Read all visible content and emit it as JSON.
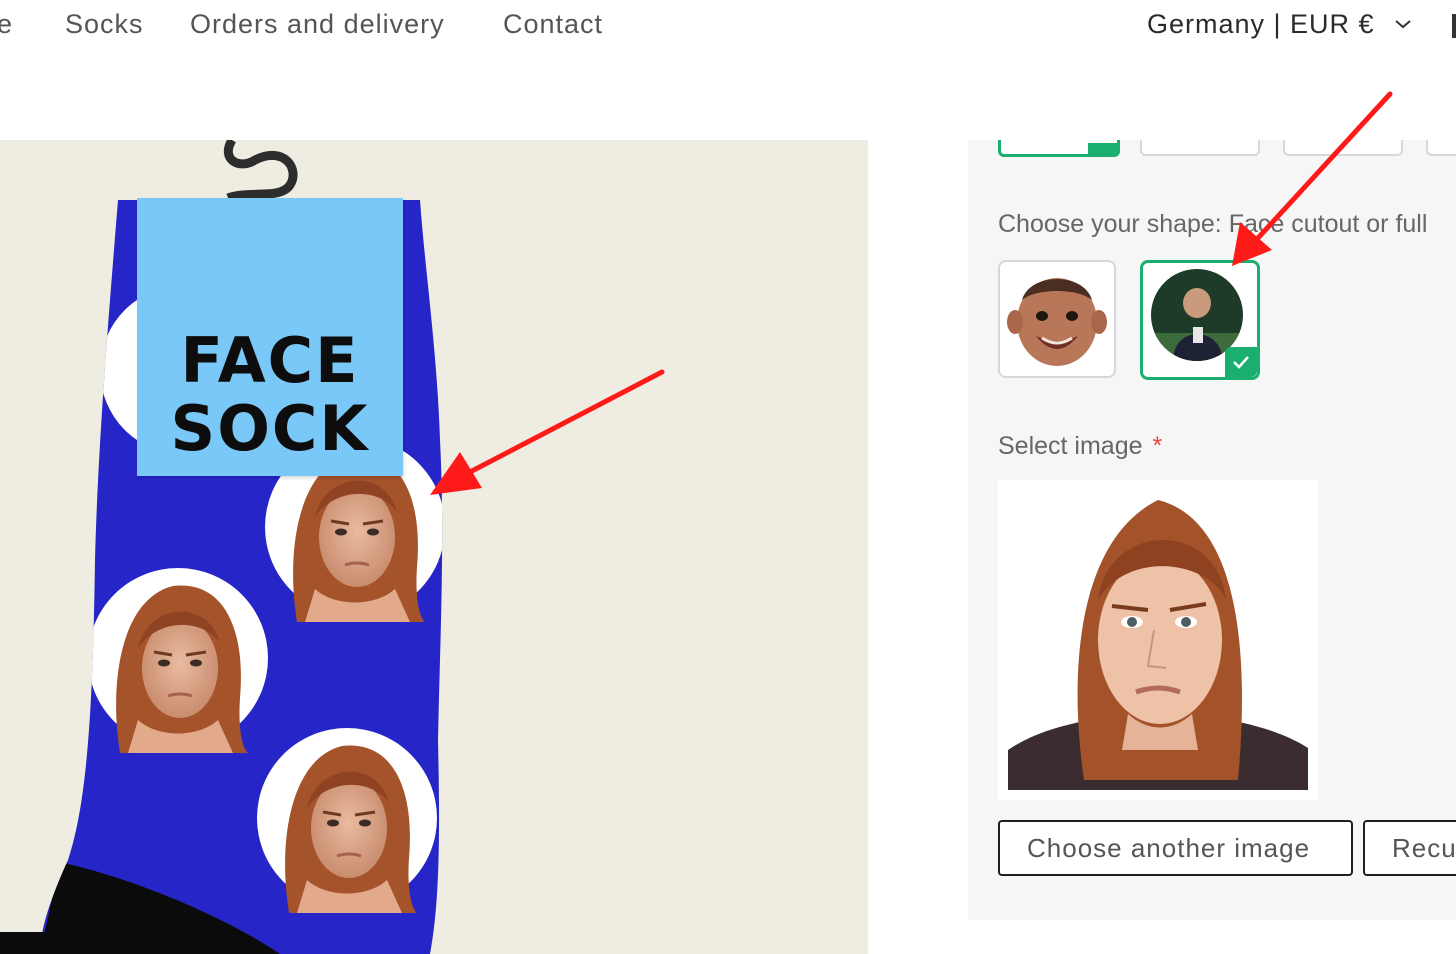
{
  "nav": {
    "links": [
      {
        "label": "e"
      },
      {
        "label": "Socks"
      },
      {
        "label": "Orders and delivery"
      },
      {
        "label": "Contact"
      }
    ],
    "region_label": "Germany | EUR €"
  },
  "preview": {
    "tag_lines": [
      "FACE",
      "SOCK"
    ],
    "sock_color": "#2525c8"
  },
  "panel": {
    "shape_label": "Choose your shape: Face cutout or full",
    "shape_options": [
      {
        "name": "Face cutout",
        "icon": "baby-face-cutout-icon",
        "selected": false
      },
      {
        "name": "Full",
        "icon": "baby-full-photo-icon",
        "selected": true
      }
    ],
    "select_image_label": "Select image",
    "required_mark": "*",
    "selected_image_icon": "woman-portrait-photo",
    "buttons": {
      "choose_another": "Choose another image",
      "recut": "Recut"
    }
  },
  "colors": {
    "accent_green": "#1aae6f",
    "annotation_red": "#ff1a1a",
    "preview_bg": "#efece1"
  }
}
